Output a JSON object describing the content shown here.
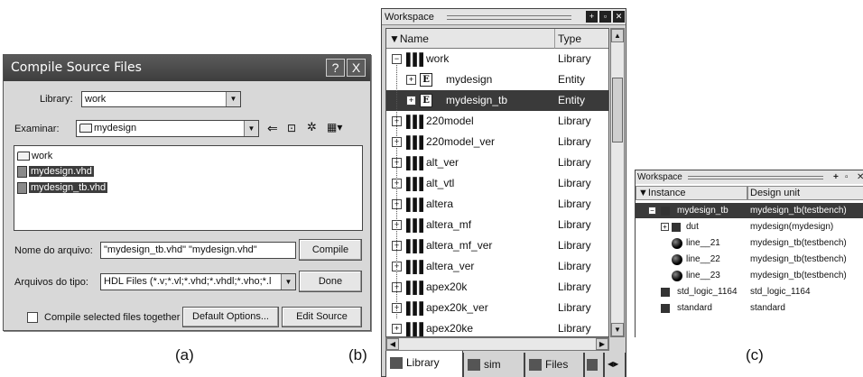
{
  "compile_dialog": {
    "title": "Compile Source Files",
    "help_btn": "?",
    "close_btn": "X",
    "library_label": "Library:",
    "library_value": "work",
    "examinar_label": "Examinar:",
    "examinar_value": "mydesign",
    "files": [
      {
        "name": "work",
        "icon": "folder-icon",
        "selected": false
      },
      {
        "name": "mydesign.vhd",
        "icon": "file-icon",
        "selected": true
      },
      {
        "name": "mydesign_tb.vhd",
        "icon": "file-icon",
        "selected": true
      }
    ],
    "filename_label": "Nome do arquivo:",
    "filename_value": "\"mydesign_tb.vhd\" \"mydesign.vhd\"",
    "filetype_label": "Arquivos do tipo:",
    "filetype_value": "HDL Files (*.v;*.vl;*.vhd;*.vhdl;*.vho;*.l",
    "compile_btn": "Compile",
    "done_btn": "Done",
    "compile_together_label": "Compile selected files together",
    "default_options_btn": "Default Options...",
    "edit_source_btn": "Edit Source"
  },
  "workspace": {
    "title": "Workspace",
    "col_name": "Name",
    "col_type": "Type",
    "rows": [
      {
        "name": "work",
        "type": "Library",
        "level": 0,
        "expander": "−",
        "icon": "library",
        "selected": false
      },
      {
        "name": "mydesign",
        "type": "Entity",
        "level": 1,
        "expander": "+",
        "icon": "entity",
        "selected": false
      },
      {
        "name": "mydesign_tb",
        "type": "Entity",
        "level": 1,
        "expander": "+",
        "icon": "entity",
        "selected": true
      },
      {
        "name": "220model",
        "type": "Library",
        "level": 0,
        "expander": "+",
        "icon": "library",
        "selected": false
      },
      {
        "name": "220model_ver",
        "type": "Library",
        "level": 0,
        "expander": "+",
        "icon": "library",
        "selected": false
      },
      {
        "name": "alt_ver",
        "type": "Library",
        "level": 0,
        "expander": "+",
        "icon": "library",
        "selected": false
      },
      {
        "name": "alt_vtl",
        "type": "Library",
        "level": 0,
        "expander": "+",
        "icon": "library",
        "selected": false
      },
      {
        "name": "altera",
        "type": "Library",
        "level": 0,
        "expander": "+",
        "icon": "library",
        "selected": false
      },
      {
        "name": "altera_mf",
        "type": "Library",
        "level": 0,
        "expander": "+",
        "icon": "library",
        "selected": false
      },
      {
        "name": "altera_mf_ver",
        "type": "Library",
        "level": 0,
        "expander": "+",
        "icon": "library",
        "selected": false
      },
      {
        "name": "altera_ver",
        "type": "Library",
        "level": 0,
        "expander": "+",
        "icon": "library",
        "selected": false
      },
      {
        "name": "apex20k",
        "type": "Library",
        "level": 0,
        "expander": "+",
        "icon": "library",
        "selected": false
      },
      {
        "name": "apex20k_ver",
        "type": "Library",
        "level": 0,
        "expander": "+",
        "icon": "library",
        "selected": false
      },
      {
        "name": "apex20ke",
        "type": "Library",
        "level": 0,
        "expander": "+",
        "icon": "library",
        "selected": false
      }
    ],
    "tabs": [
      {
        "label": "Library",
        "active": true
      },
      {
        "label": "sim",
        "active": false
      },
      {
        "label": "Files",
        "active": false
      }
    ]
  },
  "instance_ws": {
    "title": "Workspace",
    "col_instance": "Instance",
    "col_unit": "Design unit",
    "rows": [
      {
        "name": "mydesign_tb",
        "unit": "mydesign_tb(testbench)",
        "icon": "square",
        "expander": "−",
        "indent": 0,
        "selected": true
      },
      {
        "name": "dut",
        "unit": "mydesign(mydesign)",
        "icon": "square",
        "expander": "+",
        "indent": 1,
        "selected": false
      },
      {
        "name": "line__21",
        "unit": "mydesign_tb(testbench)",
        "icon": "ball",
        "expander": "",
        "indent": 1,
        "selected": false
      },
      {
        "name": "line__22",
        "unit": "mydesign_tb(testbench)",
        "icon": "ball",
        "expander": "",
        "indent": 1,
        "selected": false
      },
      {
        "name": "line__23",
        "unit": "mydesign_tb(testbench)",
        "icon": "ball",
        "expander": "",
        "indent": 1,
        "selected": false
      },
      {
        "name": "std_logic_1164",
        "unit": "std_logic_1164",
        "icon": "square",
        "expander": "",
        "indent": 0,
        "selected": false
      },
      {
        "name": "standard",
        "unit": "standard",
        "icon": "square",
        "expander": "",
        "indent": 0,
        "selected": false
      }
    ]
  },
  "captions": {
    "a": "(a)",
    "b": "(b)",
    "c": "(c)"
  }
}
